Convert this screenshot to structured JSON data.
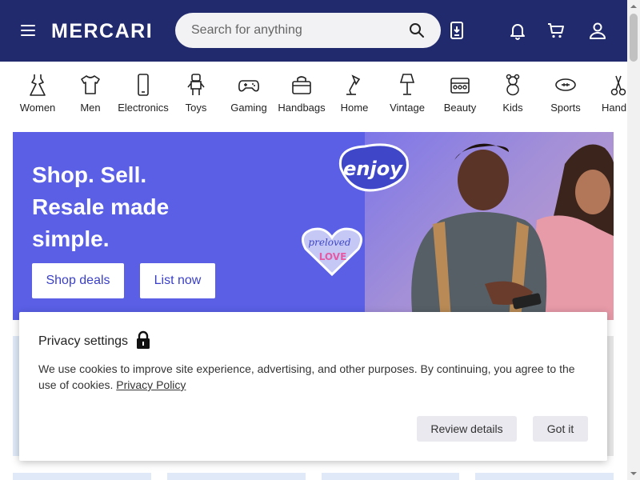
{
  "header": {
    "logo": "MERCARI",
    "search_placeholder": "Search for anything"
  },
  "categories": [
    {
      "label": "Women",
      "icon": "dress-icon"
    },
    {
      "label": "Men",
      "icon": "tshirt-icon"
    },
    {
      "label": "Electronics",
      "icon": "phone-icon"
    },
    {
      "label": "Toys",
      "icon": "robot-toy-icon"
    },
    {
      "label": "Gaming",
      "icon": "gamepad-icon"
    },
    {
      "label": "Handbags",
      "icon": "handbag-icon"
    },
    {
      "label": "Home",
      "icon": "lamp-icon"
    },
    {
      "label": "Vintage",
      "icon": "vintage-lamp-icon"
    },
    {
      "label": "Beauty",
      "icon": "palette-icon"
    },
    {
      "label": "Kids",
      "icon": "teddy-bear-icon"
    },
    {
      "label": "Sports",
      "icon": "football-icon"
    },
    {
      "label": "Handm",
      "icon": "handmade-icon"
    }
  ],
  "hero": {
    "title_line1": "Shop. Sell.",
    "title_line2": "Resale made",
    "title_line3": "simple.",
    "shop_button": "Shop deals",
    "list_button": "List now",
    "sticker_enjoy": "enjoy",
    "sticker_preloved_1": "preloved",
    "sticker_preloved_2": "LOVE"
  },
  "privacy": {
    "title": "Privacy settings",
    "text": "We use cookies to improve site experience, advertising, and other purposes. By continuing, you agree to the use of cookies.",
    "link": "Privacy Policy",
    "review_button": "Review details",
    "accept_button": "Got it"
  },
  "colors": {
    "header_bg": "#222a6e",
    "hero_bg": "#5a5fe6",
    "accent_text": "#3a3fc7"
  }
}
